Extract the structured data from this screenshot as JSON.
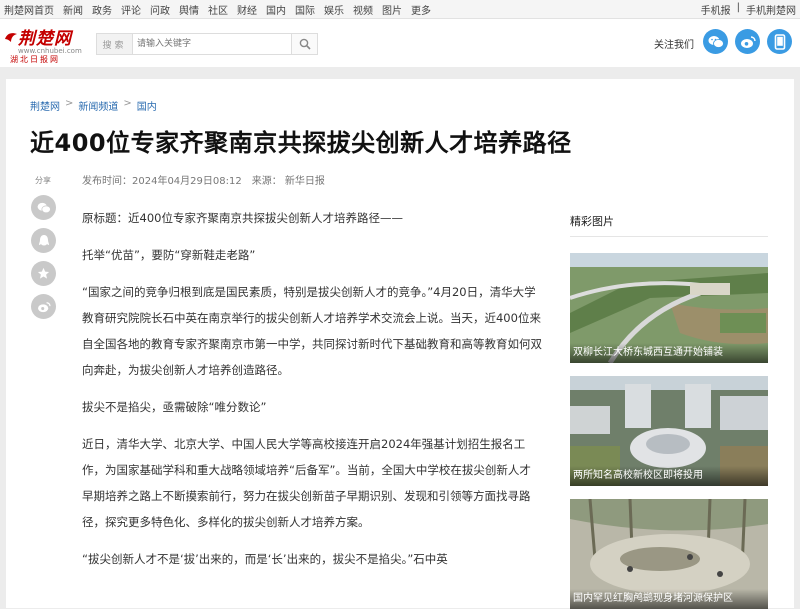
{
  "topnav": {
    "items": [
      "荆楚网首页",
      "新闻",
      "政务",
      "评论",
      "问政",
      "舆情",
      "社区",
      "财经",
      "国内",
      "国际",
      "娱乐",
      "视频",
      "图片",
      "更多"
    ],
    "mobile": "手机报",
    "separator": "|",
    "mobile_site": "手机荆楚网"
  },
  "logo": {
    "brand": "荆楚网",
    "domain": "www.cnhubei.com",
    "sub": "湖北日报网"
  },
  "search": {
    "label": "搜索",
    "placeholder": "请输入关键字"
  },
  "header": {
    "follow": "关注我们"
  },
  "breadcrumb": [
    "荆楚网",
    "新闻频道",
    "国内"
  ],
  "breadcrumb_sep": ">",
  "article": {
    "title": "近400位专家齐聚南京共探拔尖创新人才培养路径",
    "publish_time": "发布时间：2024年04月29日08:12",
    "source": "来源： 新华日报",
    "share_label": "分享",
    "paragraphs": [
      "原标题：近400位专家齐聚南京共探拔尖创新人才培养路径——",
      "托举“优苗”，要防“穿新鞋走老路”",
      "“国家之间的竞争归根到底是国民素质，特别是拔尖创新人才的竞争。”4月20日，清华大学教育研究院院长石中英在南京举行的拔尖创新人才培养学术交流会上说。当天，近400位来自全国各地的教育专家齐聚南京市第一中学，共同探讨新时代下基础教育和高等教育如何双向奔赴，为拔尖创新人才培养创造路径。",
      "拔尖不是掐尖，亟需破除“唯分数论”",
      "近日，清华大学、北京大学、中国人民大学等高校接连开启2024年强基计划招生报名工作，为国家基础学科和重大战略领域培养“后备军”。当前，全国大中学校在拔尖创新人才早期培养之路上不断摸索前行，努力在拔尖创新苗子早期识别、发现和引领等方面找寻路径，探究更多特色化、多样化的拔尖创新人才培养方案。",
      "“拔尖创新人才不是‘拔’出来的，而是‘长’出来的，拔尖不是掐尖。”石中英"
    ]
  },
  "sidebar": {
    "title": "精彩图片",
    "pictures": [
      {
        "caption": "双柳长江大桥东城西互通开始铺装"
      },
      {
        "caption": "两所知名高校新校区即将投用"
      },
      {
        "caption": "国内罕见红胸鸬鹚现身堵河源保护区"
      }
    ]
  },
  "colors": {
    "brand_red": "#c40000",
    "link_blue": "#2b6cb0",
    "social_blue": "#3a9be3",
    "share_gray": "#c9c9c9"
  },
  "icons": [
    "search-icon",
    "wechat-icon",
    "weibo-icon",
    "mobile-icon",
    "comment-icon",
    "qq-icon",
    "star-icon"
  ]
}
